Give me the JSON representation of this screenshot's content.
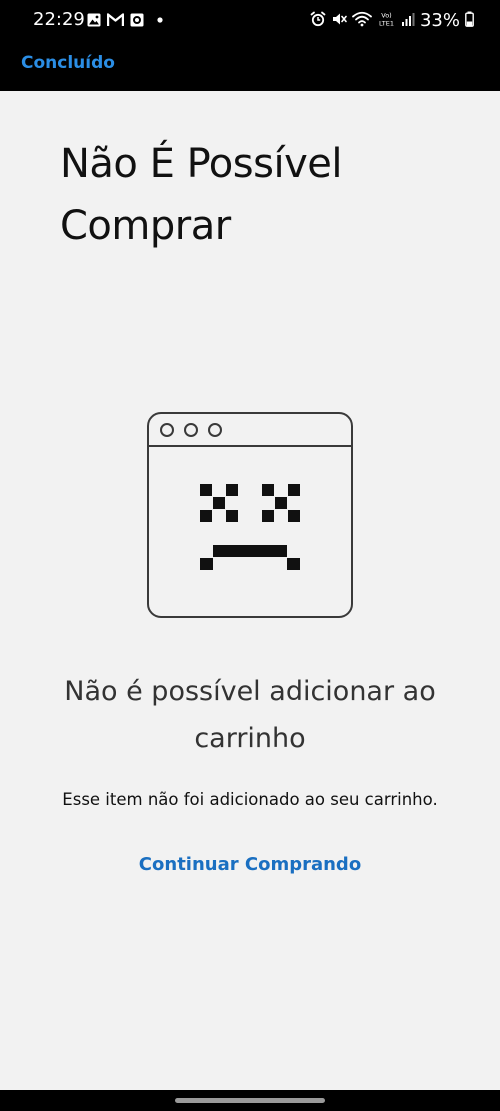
{
  "status_bar": {
    "time": "22:29",
    "left_icons": [
      "image-icon",
      "gmail-icon",
      "app-icon",
      "dot-icon"
    ],
    "right_icons": [
      "alarm-icon",
      "mute-icon",
      "wifi-icon",
      "volte-icon",
      "signal-icon",
      "battery-icon"
    ],
    "volte_label": "Vo)\nLTE1",
    "battery": "33%"
  },
  "nav": {
    "done_label": "Concluído",
    "accent_color": "#2b8ee5"
  },
  "main": {
    "title": "Não É Possível Comprar",
    "illustration_icon": "sad-browser-window-icon",
    "error_heading": "Não é possível adicionar ao carrinho",
    "error_message": "Esse item não foi adicionado ao seu carrinho.",
    "continue_label": "Continuar Comprando",
    "link_color": "#1a6fc1"
  }
}
